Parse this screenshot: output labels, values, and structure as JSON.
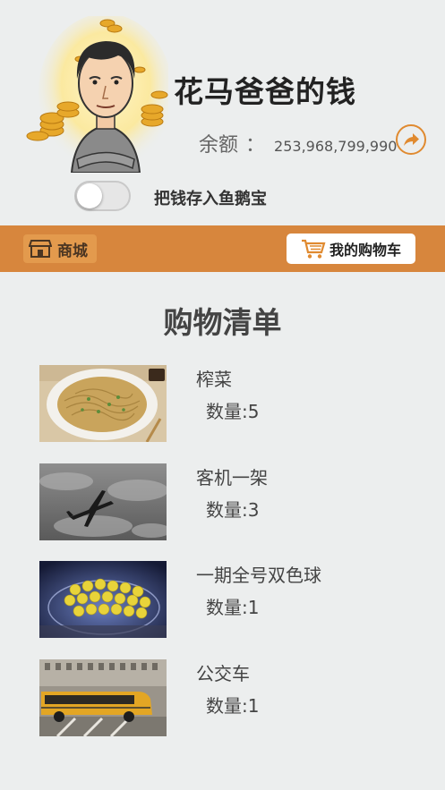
{
  "header": {
    "title": "花马爸爸的钱",
    "balance_label": "余额",
    "balance_sep": "：",
    "balance_value": "253,968,799,990",
    "share_icon": "share-arrow-icon",
    "toggle_label": "把钱存入鱼鹅宝",
    "toggle_on": false
  },
  "navbar": {
    "background": "#d7863d",
    "shop_label": "商城",
    "cart_label": "我的购物车"
  },
  "list": {
    "title": "购物清单",
    "items": [
      {
        "name": "榨菜",
        "qty": "数量:5",
        "image": "noodles"
      },
      {
        "name": "客机一架",
        "qty": "数量:3",
        "image": "airplane"
      },
      {
        "name": "一期全号双色球",
        "qty": "数量:1",
        "image": "lottery-balls"
      },
      {
        "name": "公交车",
        "qty": "数量:1",
        "image": "school-bus"
      }
    ]
  }
}
